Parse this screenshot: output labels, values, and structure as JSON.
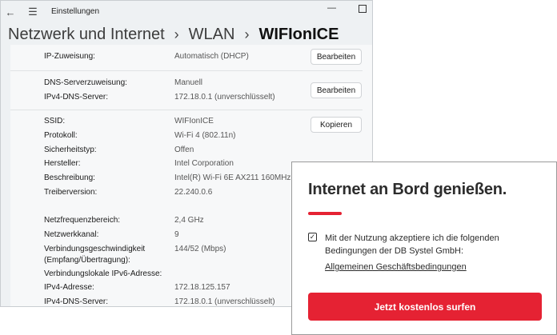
{
  "window": {
    "title": "Einstellungen",
    "back_icon": "←",
    "menu_icon": "☰",
    "minimize_icon": "—"
  },
  "breadcrumb": {
    "items": [
      "Netzwerk und Internet",
      "WLAN",
      "WIFIonICE"
    ],
    "separator": "›"
  },
  "ip_section": {
    "rows": [
      {
        "label": "IP-Zuweisung:",
        "value": "Automatisch (DHCP)"
      }
    ],
    "button": "Bearbeiten"
  },
  "dns_section": {
    "rows": [
      {
        "label": "DNS-Serverzuweisung:",
        "value": "Manuell"
      },
      {
        "label": "IPv4-DNS-Server:",
        "value": "172.18.0.1 (unverschlüsselt)"
      }
    ],
    "button": "Bearbeiten"
  },
  "properties": {
    "button": "Kopieren",
    "rows": [
      {
        "label": "SSID:",
        "value": "WIFIonICE"
      },
      {
        "label": "Protokoll:",
        "value": "Wi-Fi 4 (802.11n)"
      },
      {
        "label": "Sicherheitstyp:",
        "value": "Offen"
      },
      {
        "label": "Hersteller:",
        "value": "Intel Corporation"
      },
      {
        "label": "Beschreibung:",
        "value": "Intel(R) Wi-Fi 6E AX211 160MHz"
      },
      {
        "label": "Treiberversion:",
        "value": "22.240.0.6"
      },
      {
        "label": "Netzfrequenzbereich:",
        "value": "2,4 GHz"
      },
      {
        "label": "Netzwerkkanal:",
        "value": "9"
      },
      {
        "label": "Verbindungsgeschwindigkeit",
        "value": "144/52 (Mbps)"
      },
      {
        "label": "(Empfang/Übertragung):",
        "value": ""
      },
      {
        "label": "Verbindungslokale IPv6-Adresse:",
        "value": ""
      },
      {
        "label": "IPv4-Adresse:",
        "value": "172.18.125.157"
      },
      {
        "label": "IPv4-DNS-Server:",
        "value": "172.18.0.1 (unverschlüsselt)"
      }
    ]
  },
  "portal": {
    "title": "Internet an Bord genießen.",
    "checkbox_checked": true,
    "checkbox_mark": "✓",
    "consent_text": "Mit der Nutzung akzeptiere ich die folgenden Bedingungen der DB Systel GmbH:",
    "terms_link": "Allgemeinen Geschäftsbedingungen",
    "cta_label": "Jetzt kostenlos surfen",
    "accent_color": "#e52233"
  }
}
